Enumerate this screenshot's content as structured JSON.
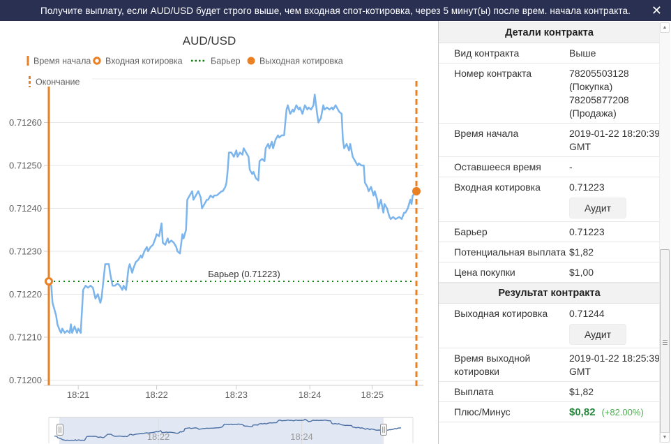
{
  "topbar": {
    "description": "Получите выплату, если AUD/USD будет строго выше, чем входная спот-котировка, через 5 минут(ы) после врем. начала контракта.",
    "close_label": "✕"
  },
  "colors": {
    "topbar_navy": "#2a3052",
    "accent_orange": "#e98024",
    "series_blue": "#7cb5ec",
    "barrier_green": "#067f06",
    "profit_green": "#2a873e",
    "profit_green_light": "#4caf50",
    "grid_grey": "#e6e6e6",
    "axis_grey": "#cccccc",
    "label_grey": "#606060",
    "navigator_line": "#4a6fa5",
    "navigator_shade": "#e2e8f3"
  },
  "chart": {
    "title": "AUD/USD",
    "legend": {
      "start_time": "Время начала",
      "entry_spot": "Входная котировка",
      "barrier": "Барьер",
      "exit_spot": "Выходная котировка",
      "end_time": "Окончание"
    },
    "barrier_annotation": "Барьер (0.71223)"
  },
  "chart_data": {
    "type": "line",
    "title": "AUD/USD",
    "x_unit": "seconds since contract start 18:20:39 GMT",
    "x_range": [
      0,
      300
    ],
    "ylim": [
      0.712,
      0.71266
    ],
    "grid": true,
    "y_ticks": [
      0.712,
      0.7121,
      0.7122,
      0.7123,
      0.7124,
      0.7125,
      0.7126
    ],
    "x_ticks": [
      {
        "t": 24,
        "label": "18:21"
      },
      {
        "t": 88,
        "label": "18:22"
      },
      {
        "t": 153,
        "label": "18:23"
      },
      {
        "t": 213,
        "label": "18:24"
      },
      {
        "t": 264,
        "label": "18:25"
      }
    ],
    "nav_ticks": [
      {
        "t": 90,
        "label": "18:22"
      },
      {
        "t": 214,
        "label": "18:24"
      }
    ],
    "barrier": 0.71223,
    "entry": {
      "t": 0,
      "value": 0.71223
    },
    "exit": {
      "t": 300,
      "value": 0.71244
    },
    "series": [
      {
        "name": "AUD/USD",
        "points": [
          [
            0,
            0.712225
          ],
          [
            2,
            0.71222
          ],
          [
            3,
            0.71218
          ],
          [
            5,
            0.71216
          ],
          [
            6,
            0.71215
          ],
          [
            7,
            0.71213
          ],
          [
            9,
            0.712115
          ],
          [
            10,
            0.71211
          ],
          [
            11,
            0.71212
          ],
          [
            13,
            0.71211
          ],
          [
            15,
            0.712115
          ],
          [
            17,
            0.71211
          ],
          [
            18,
            0.71213
          ],
          [
            19,
            0.71211
          ],
          [
            21,
            0.712125
          ],
          [
            23,
            0.71211
          ],
          [
            24,
            0.71212
          ],
          [
            26,
            0.71211
          ],
          [
            28,
            0.71221
          ],
          [
            30,
            0.71222
          ],
          [
            32,
            0.712215
          ],
          [
            34,
            0.71222
          ],
          [
            36,
            0.712215
          ],
          [
            38,
            0.71219
          ],
          [
            40,
            0.7122
          ],
          [
            42,
            0.71218
          ],
          [
            43,
            0.71219
          ],
          [
            46,
            0.71227
          ],
          [
            47,
            0.71227
          ],
          [
            49,
            0.71227
          ],
          [
            50,
            0.71225
          ],
          [
            52,
            0.71222
          ],
          [
            54,
            0.71222
          ],
          [
            56,
            0.712225
          ],
          [
            58,
            0.71222
          ],
          [
            60,
            0.71221
          ],
          [
            61,
            0.71222
          ],
          [
            63,
            0.71221
          ],
          [
            65,
            0.71226
          ],
          [
            66,
            0.71227
          ],
          [
            68,
            0.71225
          ],
          [
            69,
            0.71226
          ],
          [
            71,
            0.712275
          ],
          [
            73,
            0.71228
          ],
          [
            75,
            0.71229
          ],
          [
            76,
            0.712285
          ],
          [
            78,
            0.7123
          ],
          [
            80,
            0.71231
          ],
          [
            81,
            0.7123
          ],
          [
            83,
            0.71231
          ],
          [
            85,
            0.712315
          ],
          [
            87,
            0.71233
          ],
          [
            88,
            0.71234
          ],
          [
            90,
            0.712335
          ],
          [
            92,
            0.712365
          ],
          [
            93,
            0.71232
          ],
          [
            95,
            0.712315
          ],
          [
            97,
            0.71233
          ],
          [
            98,
            0.71232
          ],
          [
            100,
            0.712325
          ],
          [
            102,
            0.71232
          ],
          [
            104,
            0.71231
          ],
          [
            105,
            0.7123
          ],
          [
            107,
            0.712295
          ],
          [
            109,
            0.71234
          ],
          [
            110,
            0.71233
          ],
          [
            112,
            0.71235
          ],
          [
            113,
            0.71242
          ],
          [
            115,
            0.71243
          ],
          [
            117,
            0.71244
          ],
          [
            118,
            0.71242
          ],
          [
            120,
            0.71243
          ],
          [
            122,
            0.71244
          ],
          [
            124,
            0.712425
          ],
          [
            125,
            0.7124
          ],
          [
            127,
            0.71241
          ],
          [
            129,
            0.71242
          ],
          [
            130,
            0.71242
          ],
          [
            132,
            0.71243
          ],
          [
            134,
            0.712425
          ],
          [
            135,
            0.71243
          ],
          [
            137,
            0.71243
          ],
          [
            139,
            0.712435
          ],
          [
            141,
            0.71244
          ],
          [
            142,
            0.71244
          ],
          [
            144,
            0.71245
          ],
          [
            145,
            0.71246
          ],
          [
            146,
            0.71249
          ],
          [
            147,
            0.71253
          ],
          [
            149,
            0.71253
          ],
          [
            151,
            0.71252
          ],
          [
            153,
            0.712535
          ],
          [
            154,
            0.71252
          ],
          [
            156,
            0.71253
          ],
          [
            158,
            0.712525
          ],
          [
            159,
            0.71254
          ],
          [
            161,
            0.71253
          ],
          [
            163,
            0.71252
          ],
          [
            164,
            0.71249
          ],
          [
            166,
            0.71248
          ],
          [
            167,
            0.712485
          ],
          [
            169,
            0.71247
          ],
          [
            171,
            0.712465
          ],
          [
            172,
            0.71251
          ],
          [
            174,
            0.712515
          ],
          [
            176,
            0.71251
          ],
          [
            177,
            0.71254
          ],
          [
            179,
            0.71255
          ],
          [
            180,
            0.71254
          ],
          [
            182,
            0.712555
          ],
          [
            183,
            0.71254
          ],
          [
            185,
            0.71256
          ],
          [
            187,
            0.71257
          ],
          [
            188,
            0.712565
          ],
          [
            190,
            0.71257
          ],
          [
            192,
            0.71257
          ],
          [
            194,
            0.71263
          ],
          [
            195,
            0.71264
          ],
          [
            197,
            0.71262
          ],
          [
            199,
            0.71263
          ],
          [
            200,
            0.712625
          ],
          [
            202,
            0.71264
          ],
          [
            204,
            0.71263
          ],
          [
            205,
            0.712635
          ],
          [
            207,
            0.71262
          ],
          [
            209,
            0.71264
          ],
          [
            211,
            0.71263
          ],
          [
            212,
            0.712635
          ],
          [
            214,
            0.71263
          ],
          [
            216,
            0.71264
          ],
          [
            217,
            0.712665
          ],
          [
            219,
            0.71262
          ],
          [
            220,
            0.7126
          ],
          [
            222,
            0.71261
          ],
          [
            224,
            0.71264
          ],
          [
            225,
            0.71263
          ],
          [
            227,
            0.712635
          ],
          [
            229,
            0.71263
          ],
          [
            231,
            0.712635
          ],
          [
            232,
            0.71263
          ],
          [
            234,
            0.71264
          ],
          [
            236,
            0.71263
          ],
          [
            237,
            0.712625
          ],
          [
            239,
            0.71262
          ],
          [
            240,
            0.71256
          ],
          [
            241,
            0.71254
          ],
          [
            243,
            0.71255
          ],
          [
            245,
            0.712535
          ],
          [
            246,
            0.71255
          ],
          [
            248,
            0.71252
          ],
          [
            250,
            0.71251
          ],
          [
            252,
            0.7125
          ],
          [
            253,
            0.712505
          ],
          [
            255,
            0.7125
          ],
          [
            257,
            0.7125
          ],
          [
            258,
            0.71246
          ],
          [
            260,
            0.71245
          ],
          [
            261,
            0.71244
          ],
          [
            263,
            0.71245
          ],
          [
            265,
            0.71243
          ],
          [
            266,
            0.71244
          ],
          [
            268,
            0.71242
          ],
          [
            269,
            0.7124
          ],
          [
            271,
            0.71242
          ],
          [
            273,
            0.71239
          ],
          [
            274,
            0.71241
          ],
          [
            276,
            0.7124
          ],
          [
            278,
            0.71238
          ],
          [
            279,
            0.712375
          ],
          [
            281,
            0.71238
          ],
          [
            283,
            0.712375
          ],
          [
            286,
            0.71238
          ],
          [
            288,
            0.712375
          ],
          [
            290,
            0.71239
          ],
          [
            291,
            0.71239
          ],
          [
            293,
            0.7124
          ],
          [
            295,
            0.71242
          ],
          [
            296,
            0.71241
          ],
          [
            297,
            0.71243
          ],
          [
            299,
            0.712435
          ],
          [
            300,
            0.71244
          ]
        ]
      }
    ]
  },
  "sidebar": {
    "details_header": "Детали контракта",
    "contract_type": {
      "label": "Вид контракта",
      "value": "Выше"
    },
    "contract_number": {
      "label": "Номер контракта",
      "lines": [
        "78205503128",
        "(Покупка)",
        "78205877208",
        "(Продажа)"
      ]
    },
    "start_time": {
      "label": "Время начала",
      "line1": "2019-01-22 18:20:39",
      "line2": "GMT"
    },
    "remaining_time": {
      "label": "Оставшееся время",
      "value": "-"
    },
    "entry_spot": {
      "label": "Входная котировка",
      "value": "0.71223",
      "button_label": "Аудит"
    },
    "barrier": {
      "label": "Барьер",
      "value": "0.71223"
    },
    "potential_payout": {
      "label": "Потенциальная выплата",
      "value": "$1,82"
    },
    "purchase_price": {
      "label": "Цена покупки",
      "value": "$1,00"
    },
    "result_header": "Результат контракта",
    "exit_spot": {
      "label": "Выходная котировка",
      "value": "0.71244",
      "button_label": "Аудит"
    },
    "exit_time": {
      "label": "Время выходной котировки",
      "line1": "2019-01-22 18:25:39",
      "line2": "GMT"
    },
    "payout": {
      "label": "Выплата",
      "value": "$1,82"
    },
    "profit_loss": {
      "label": "Плюс/Минус",
      "value": "$0,82",
      "percent": "(+82.00%)"
    }
  }
}
